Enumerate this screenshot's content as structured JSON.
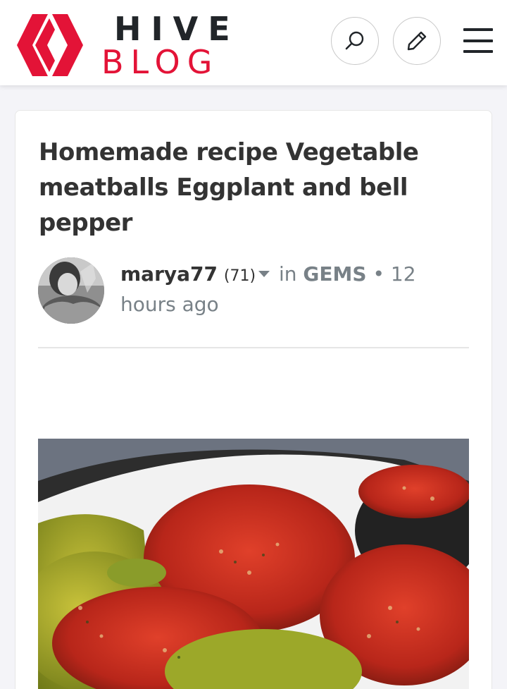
{
  "header": {
    "logo_line1": "HIVE",
    "logo_line2": "BLOG",
    "brand_color": "#e31337",
    "search_icon": "search-icon",
    "post_icon": "pencil-icon",
    "menu_icon": "hamburger-menu-icon"
  },
  "post": {
    "title": "Homemade recipe Vegetable meatballs Eggplant and bell pepper",
    "author": "marya77",
    "reputation": "(71)",
    "in_label": "in",
    "community": "GEMS",
    "separator": "•",
    "time": "12 hours ago",
    "image_subject": "stuffed bell peppers and eggplant with tomato sauce"
  }
}
